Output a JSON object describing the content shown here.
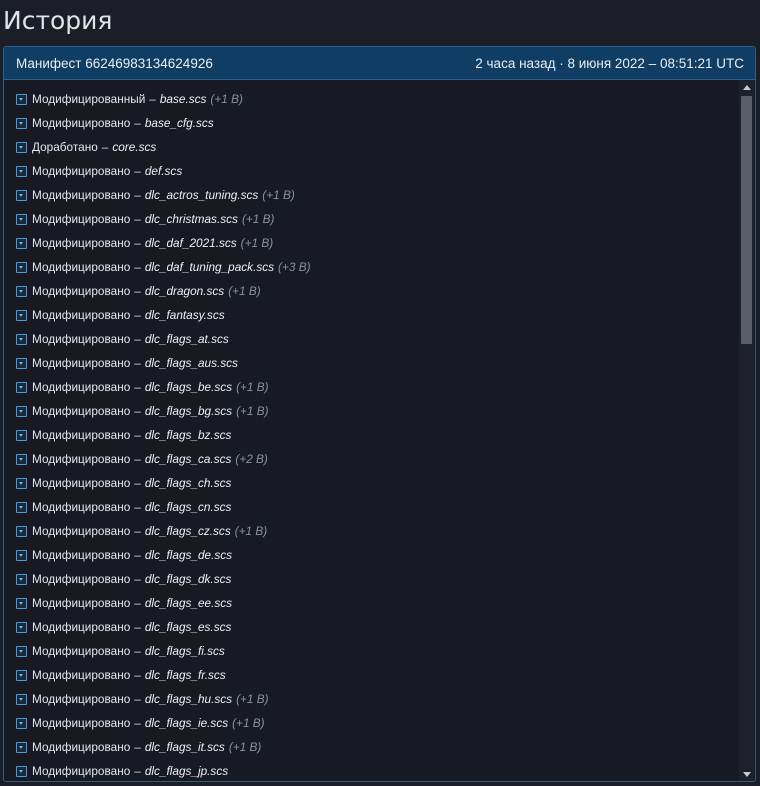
{
  "page": {
    "title": "История"
  },
  "manifest": {
    "label": "Манифест 66246983134624926",
    "timestamp": "2 часа назад · 8 июня 2022 – 08:51:21 UTC"
  },
  "changes": [
    {
      "action": "Модифицированный",
      "file": "base.scs",
      "extra": "(+1 B)"
    },
    {
      "action": "Модифицировано",
      "file": "base_cfg.scs",
      "extra": ""
    },
    {
      "action": "Доработано",
      "file": "core.scs",
      "extra": ""
    },
    {
      "action": "Модифицировано",
      "file": "def.scs",
      "extra": ""
    },
    {
      "action": "Модифицировано",
      "file": "dlc_actros_tuning.scs",
      "extra": "(+1 B)"
    },
    {
      "action": "Модифицировано",
      "file": "dlc_christmas.scs",
      "extra": "(+1 B)"
    },
    {
      "action": "Модифицировано",
      "file": "dlc_daf_2021.scs",
      "extra": "(+1 B)"
    },
    {
      "action": "Модифицировано",
      "file": "dlc_daf_tuning_pack.scs",
      "extra": "(+3 B)"
    },
    {
      "action": "Модифицировано",
      "file": "dlc_dragon.scs",
      "extra": "(+1 B)"
    },
    {
      "action": "Модифицировано",
      "file": "dlc_fantasy.scs",
      "extra": ""
    },
    {
      "action": "Модифицировано",
      "file": "dlc_flags_at.scs",
      "extra": ""
    },
    {
      "action": "Модифицировано",
      "file": "dlc_flags_aus.scs",
      "extra": ""
    },
    {
      "action": "Модифицировано",
      "file": "dlc_flags_be.scs",
      "extra": "(+1 B)"
    },
    {
      "action": "Модифицировано",
      "file": "dlc_flags_bg.scs",
      "extra": "(+1 B)"
    },
    {
      "action": "Модифицировано",
      "file": "dlc_flags_bz.scs",
      "extra": ""
    },
    {
      "action": "Модифицировано",
      "file": "dlc_flags_ca.scs",
      "extra": "(+2 B)"
    },
    {
      "action": "Модифицировано",
      "file": "dlc_flags_ch.scs",
      "extra": ""
    },
    {
      "action": "Модифицировано",
      "file": "dlc_flags_cn.scs",
      "extra": ""
    },
    {
      "action": "Модифицировано",
      "file": "dlc_flags_cz.scs",
      "extra": "(+1 B)"
    },
    {
      "action": "Модифицировано",
      "file": "dlc_flags_de.scs",
      "extra": ""
    },
    {
      "action": "Модифицировано",
      "file": "dlc_flags_dk.scs",
      "extra": ""
    },
    {
      "action": "Модифицировано",
      "file": "dlc_flags_ee.scs",
      "extra": ""
    },
    {
      "action": "Модифицировано",
      "file": "dlc_flags_es.scs",
      "extra": ""
    },
    {
      "action": "Модифицировано",
      "file": "dlc_flags_fi.scs",
      "extra": ""
    },
    {
      "action": "Модифицировано",
      "file": "dlc_flags_fr.scs",
      "extra": ""
    },
    {
      "action": "Модифицировано",
      "file": "dlc_flags_hu.scs",
      "extra": "(+1 B)"
    },
    {
      "action": "Модифицировано",
      "file": "dlc_flags_ie.scs",
      "extra": "(+1 B)"
    },
    {
      "action": "Модифицировано",
      "file": "dlc_flags_it.scs",
      "extra": "(+1 B)"
    },
    {
      "action": "Модифицировано",
      "file": "dlc_flags_jp.scs",
      "extra": ""
    }
  ],
  "separator": "–",
  "colors": {
    "background": "#1b1e27",
    "header": "#0f3d63",
    "border": "#2b5f86",
    "icon": "#4f9ad6"
  }
}
